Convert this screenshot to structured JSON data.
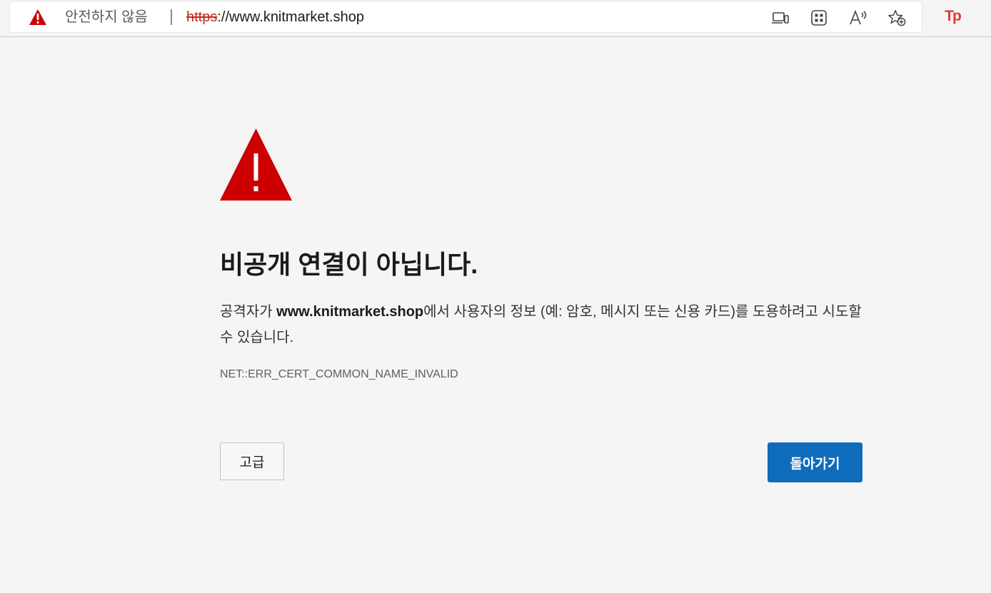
{
  "toolbar": {
    "security_status": "안전하지 않음",
    "url_scheme": "https",
    "url_rest": "://www.knitmarket.shop",
    "icons": [
      "warning-triangle-icon",
      "devices-icon",
      "apps-icon",
      "read-aloud-icon",
      "add-favorite-icon",
      "profile-tp-icon"
    ],
    "profile_badge": "Tp"
  },
  "error": {
    "title": "비공개 연결이 아닙니다.",
    "desc_prefix": "공격자가 ",
    "desc_host": "www.knitmarket.shop",
    "desc_suffix": "에서 사용자의 정보 (예: 암호, 메시지 또는 신용 카드)를 도용하려고 시도할 수 있습니다.",
    "code": "NET::ERR_CERT_COMMON_NAME_INVALID",
    "advanced_label": "고급",
    "back_label": "돌아가기"
  },
  "colors": {
    "warning_red": "#cc0000",
    "primary_blue": "#0f6cbd",
    "scheme_red": "#c42b1c",
    "page_bg": "#f5f5f5"
  }
}
